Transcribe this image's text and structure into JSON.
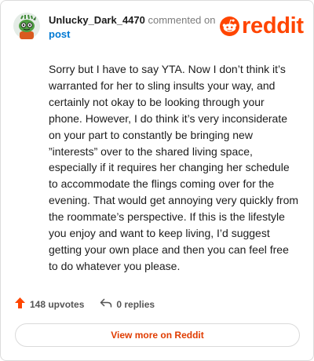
{
  "comment": {
    "author": "Unlucky_Dark_4470",
    "action_text": "commented on",
    "post_link": "post",
    "avatar_icon": "snoo-avatar-icon",
    "body": "Sorry but I have to say YTA. Now I don’t think it’s warranted for her to sling insults your way, and certainly not okay to be looking through your phone. However, I do think it’s very inconsiderate on your part to constantly be bringing new ”interests” over to the shared living space, especially if it requires her changing her schedule to accommodate the flings coming over for the evening. That would get annoying very quickly from the roommate’s perspective. If this is the lifestyle you enjoy and want to keep living, I’d suggest getting your own place and then you can feel free to do whatever you please."
  },
  "brand": {
    "wordmark": "reddit",
    "logo_icon": "reddit-snoo-icon",
    "color": "#ff4500"
  },
  "footer": {
    "upvotes": "148 upvotes",
    "upvote_icon": "upvote-arrow-icon",
    "replies": "0 replies",
    "reply_icon": "reply-arrow-icon",
    "view_more": "View more on Reddit"
  },
  "colors": {
    "accent": "#ff4500",
    "link": "#0079d3",
    "text": "#1c1c1c",
    "muted": "#7c7c7c"
  }
}
